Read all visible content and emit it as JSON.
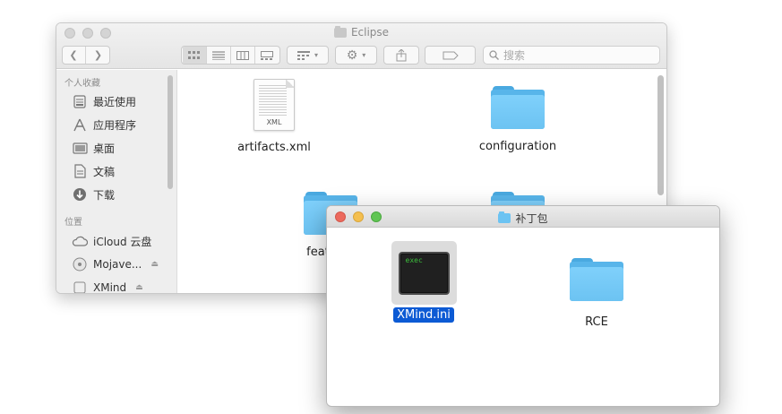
{
  "back_window": {
    "title": "Eclipse",
    "search_placeholder": "搜索",
    "sidebar": {
      "favorites_heading": "个人收藏",
      "locations_heading": "位置",
      "favorites": [
        {
          "label": "最近使用",
          "icon": "recents-icon"
        },
        {
          "label": "应用程序",
          "icon": "applications-icon"
        },
        {
          "label": "桌面",
          "icon": "desktop-icon"
        },
        {
          "label": "文稿",
          "icon": "documents-icon"
        },
        {
          "label": "下载",
          "icon": "downloads-icon"
        }
      ],
      "locations": [
        {
          "label": "iCloud 云盘",
          "icon": "icloud-icon"
        },
        {
          "label": "Mojave...",
          "icon": "disk-icon"
        },
        {
          "label": "XMind",
          "icon": "disk-icon"
        }
      ]
    },
    "files": [
      {
        "name": "artifacts.xml",
        "kind": "xml-document",
        "badge": "XML"
      },
      {
        "name": "configuration",
        "kind": "folder"
      },
      {
        "name": "features",
        "kind": "folder"
      }
    ]
  },
  "front_window": {
    "title": "补丁包",
    "files": [
      {
        "name": "XMind.ini",
        "kind": "exec-document",
        "badge": "exec",
        "selected": true
      },
      {
        "name": "RCE",
        "kind": "folder"
      }
    ]
  },
  "colors": {
    "folder_blue": "#6cc3f2",
    "selection_blue": "#0c5ad4",
    "close_red": "#ec6a5e",
    "minimize_yellow": "#f4bf4f",
    "zoom_green": "#61c554"
  }
}
